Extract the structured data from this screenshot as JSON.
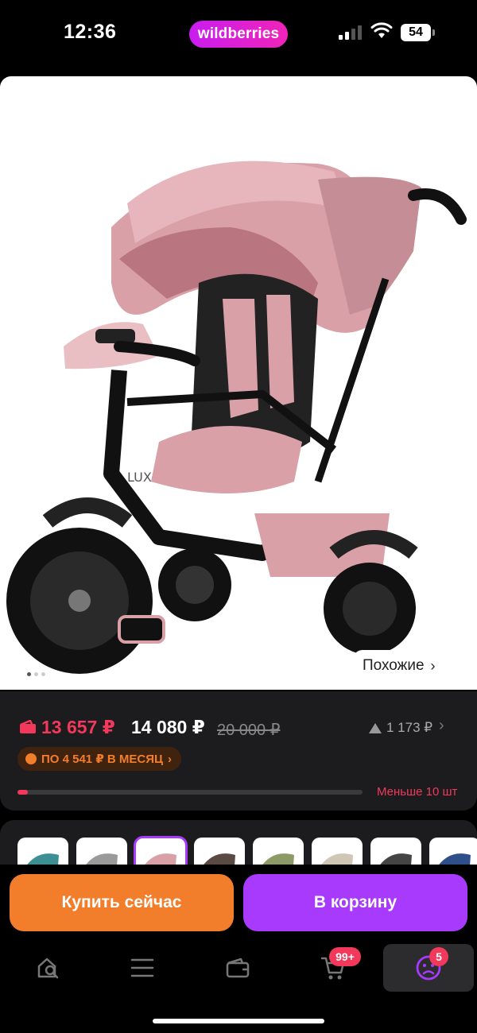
{
  "status_bar": {
    "time": "12:36",
    "app_pill": "wildberries",
    "battery": "54"
  },
  "product": {
    "similar_label": "Похожие",
    "similar_chevron": "›",
    "image_dots": 3,
    "image_description_icon": "tricycle-image"
  },
  "price": {
    "wallet_price": "13 657 ₽",
    "price": "14 080 ₽",
    "old_price": "20 000 ₽",
    "rating_value": "1 173 ₽",
    "rating_chevron": "›",
    "installment": "ПО 4 541 ₽ В МЕСЯЦ",
    "installment_chevron": "›",
    "stock_progress": 0.03,
    "stock_label": "Меньше 10 шт"
  },
  "actions": {
    "buy_now": "Купить сейчас",
    "add_to_cart": "В корзину"
  },
  "bottom_nav": {
    "cart_badge": "99+",
    "profile_badge": "5"
  },
  "colors": {
    "accent_purple": "#a73afd",
    "accent_orange": "#f27e2c",
    "accent_red": "#f2395b",
    "card_bg": "#1c1c1e"
  }
}
